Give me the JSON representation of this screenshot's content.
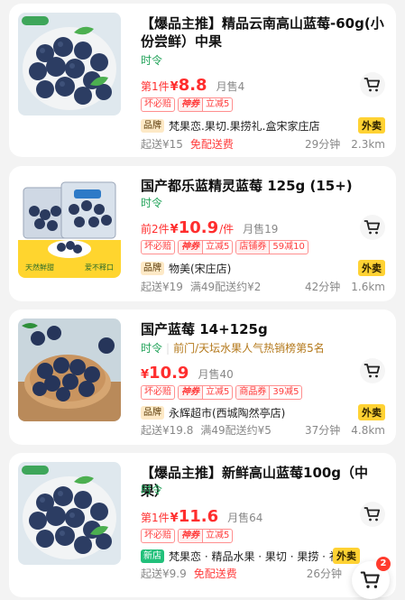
{
  "products": [
    {
      "title": "【爆品主推】精品云南高山蓝莓-60g(小份尝鲜）中果",
      "seasonal": "时令",
      "price_prefix": "第1件",
      "price": "8.8",
      "price_unit": "",
      "sold": "月售4",
      "tag_guarantee": "坏必赔",
      "tag_brand": "神券",
      "tag_discount": "立减5",
      "store_badge": "品牌",
      "store": "梵果恋.果切.果捞礼.盒宋家庄店",
      "takeout": "外卖",
      "min_order": "起送¥15",
      "delivery_fee": "免配送费",
      "eta": "29分钟",
      "distance": "2.3km"
    },
    {
      "title": "国产都乐蓝精灵蓝莓 125g (15+)",
      "seasonal": "时令",
      "price_prefix": "前2件",
      "price": "10.9",
      "price_unit": "/件",
      "sold": "月售19",
      "tag_guarantee": "坏必赔",
      "tag_brand": "神券",
      "tag_discount": "立减5",
      "tag_coupon_left": "店铺券",
      "tag_coupon_right": "59减10",
      "store_badge": "品牌",
      "store": "物美(宋庄店)",
      "takeout": "外卖",
      "min_order": "起送¥19",
      "delivery_fee": "满49配送约¥2",
      "eta": "42分钟",
      "distance": "1.6km",
      "banner_left": "天然鲜甜",
      "banner_right": "爱不释口"
    },
    {
      "title": "国产蓝莓 14+125g",
      "seasonal": "时令",
      "rank": "前门/天坛水果人气热销榜第5名",
      "price_prefix": "",
      "price": "10.9",
      "price_unit": "",
      "sold": "月售40",
      "tag_guarantee": "坏必赔",
      "tag_brand": "神券",
      "tag_discount": "立减5",
      "tag_coupon_left": "商品券",
      "tag_coupon_right": "39减5",
      "store_badge": "品牌",
      "store": "永辉超市(西城陶然亭店)",
      "takeout": "外卖",
      "min_order": "起送¥19.8",
      "delivery_fee": "满49配送约¥5",
      "eta": "37分钟",
      "distance": "4.8km"
    },
    {
      "title": "【爆品主推】新鲜高山蓝莓100g（中果）",
      "seasonal": "时令",
      "price_prefix": "第1件",
      "price": "11.6",
      "price_unit": "",
      "sold": "月售64",
      "tag_guarantee": "坏必赔",
      "tag_brand": "神券",
      "tag_discount": "立减5",
      "store_badge": "新店",
      "store": "梵果恋 · 精品水果 · 果切 · 果捞 · 礼...",
      "takeout": "外卖",
      "min_order": "起送¥9.9",
      "delivery_fee": "免配送费",
      "eta": "26分钟",
      "distance": ""
    }
  ],
  "currency": "¥",
  "cart_count": "2",
  "icons": {
    "cart": "shopping-cart-icon"
  },
  "colors": {
    "price_red": "#ff2d2d",
    "seasonal_green": "#22a35a",
    "takeout_yellow": "#ffd233"
  }
}
